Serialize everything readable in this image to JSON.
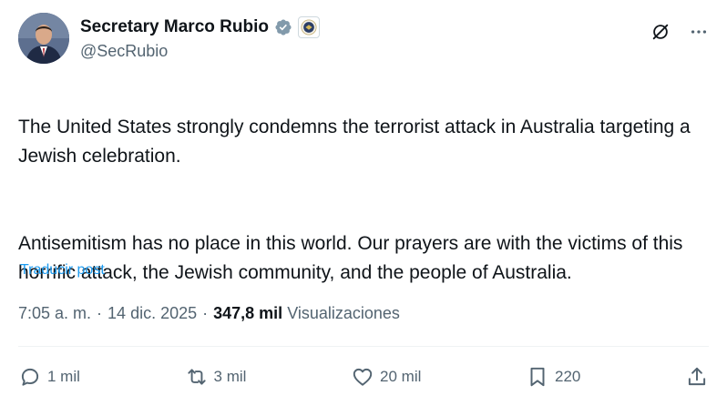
{
  "author": {
    "display_name": "Secretary Marco Rubio",
    "handle": "@SecRubio"
  },
  "post": {
    "paragraphs": [
      "The United States strongly condemns the terrorist attack in Australia targeting a Jewish celebration.",
      "Antisemitism has no place in this world. Our prayers are with the victims of this horrific attack, the Jewish community, and the people of Australia."
    ],
    "translate_label": "Traducir post"
  },
  "meta": {
    "time": "7:05 a. m.",
    "separator": "·",
    "date": "14 dic. 2025",
    "views_count": "347,8 mil",
    "views_label": "Visualizaciones"
  },
  "actions": {
    "replies": "1 mil",
    "reposts": "3 mil",
    "likes": "20 mil",
    "bookmarks": "220"
  },
  "icons": {
    "verified": "verified-badge-icon",
    "seal": "government-seal-icon",
    "grok": "grok-icon",
    "more": "more-icon",
    "reply": "reply-icon",
    "repost": "repost-icon",
    "like": "heart-icon",
    "bookmark": "bookmark-icon",
    "share": "share-icon"
  },
  "colors": {
    "text": "#0f1419",
    "muted": "#536471",
    "link": "#1d9bf0",
    "verified_badge": "#829aab"
  }
}
